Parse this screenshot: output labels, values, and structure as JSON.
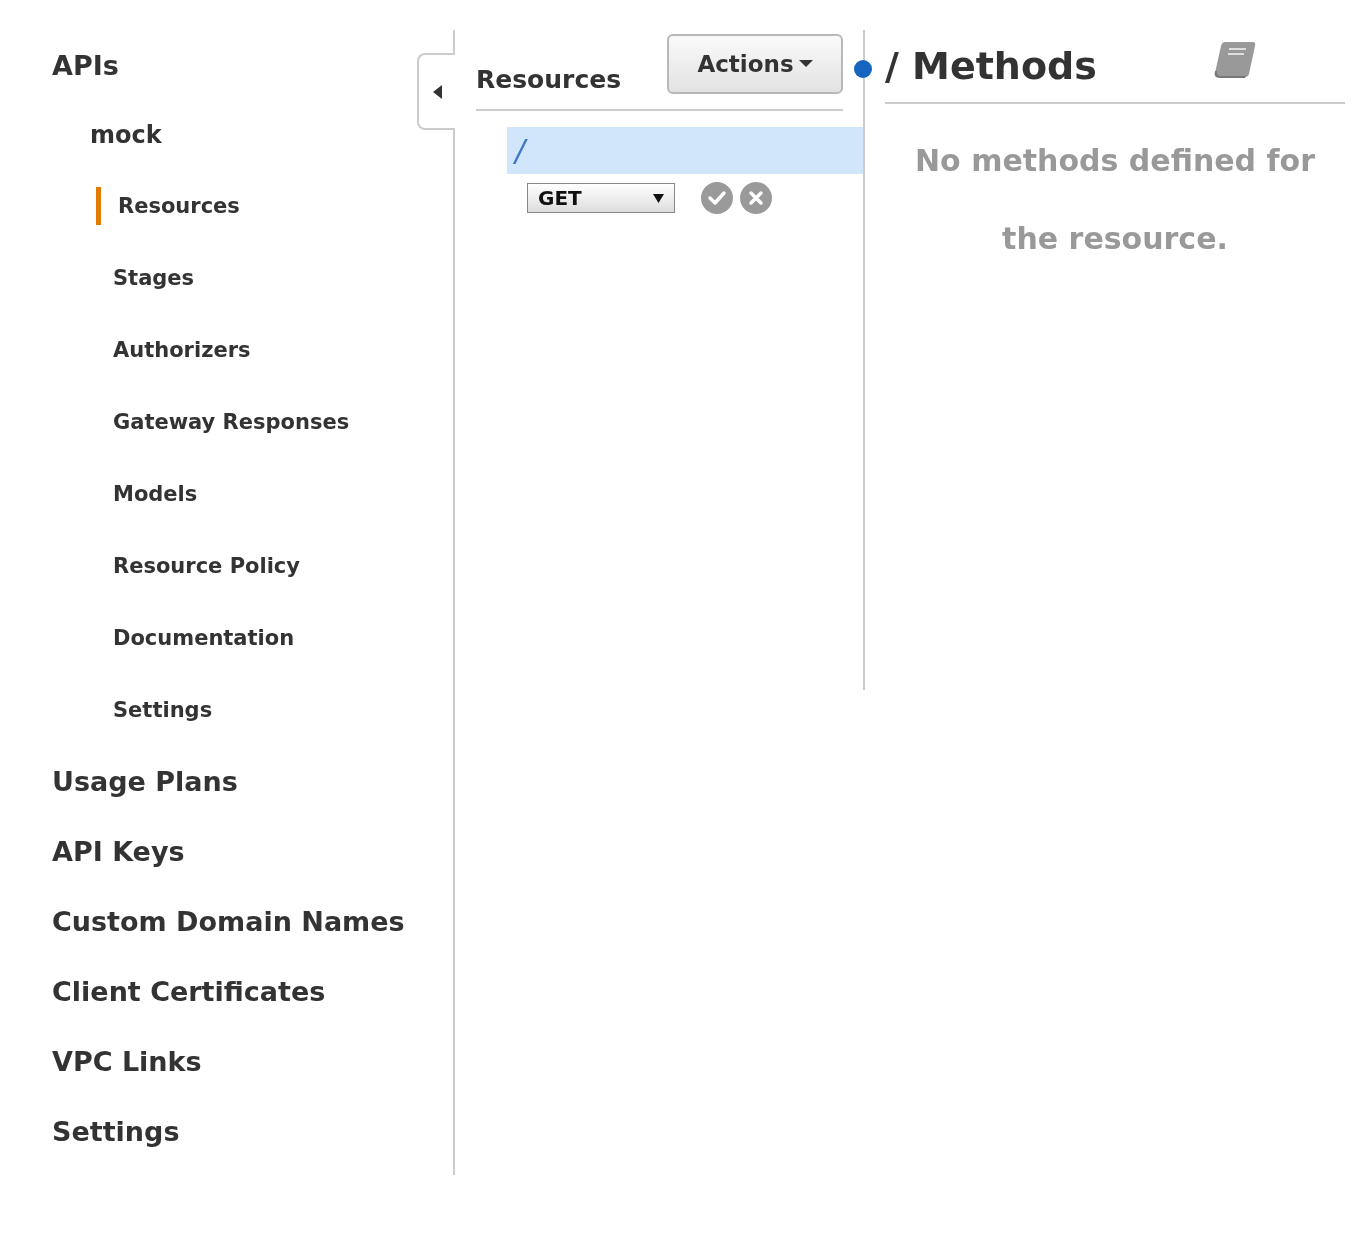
{
  "sidebar": {
    "items": [
      {
        "label": "APIs",
        "selected": false,
        "children": [
          {
            "label": "mock",
            "selected": false,
            "children": [
              {
                "label": "Resources",
                "selected": true
              },
              {
                "label": "Stages",
                "selected": false
              },
              {
                "label": "Authorizers",
                "selected": false
              },
              {
                "label": "Gateway Responses",
                "selected": false
              },
              {
                "label": "Models",
                "selected": false
              },
              {
                "label": "Resource Policy",
                "selected": false
              },
              {
                "label": "Documentation",
                "selected": false
              },
              {
                "label": "Settings",
                "selected": false
              }
            ]
          }
        ]
      },
      {
        "label": "Usage Plans",
        "selected": false
      },
      {
        "label": "API Keys",
        "selected": false
      },
      {
        "label": "Custom Domain Names",
        "selected": false
      },
      {
        "label": "Client Certificates",
        "selected": false
      },
      {
        "label": "VPC Links",
        "selected": false
      },
      {
        "label": "Settings",
        "selected": false
      }
    ]
  },
  "resources_panel": {
    "title": "Resources",
    "actions_button": "Actions",
    "tree": [
      {
        "path": "/",
        "selected": true
      }
    ],
    "method_select": {
      "value": "GET"
    }
  },
  "methods_panel": {
    "title": "/ Methods",
    "empty_message": "No methods defined for the resource."
  }
}
